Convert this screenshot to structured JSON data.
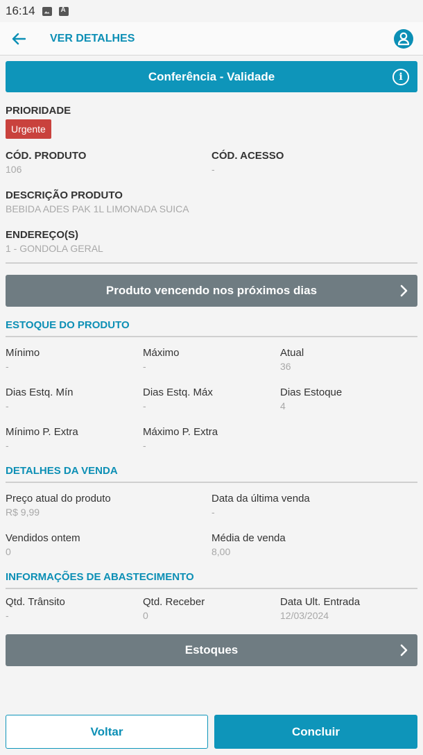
{
  "status_bar": {
    "time": "16:14"
  },
  "app_bar": {
    "title": "VER DETALHES",
    "back_icon": "arrow-left-icon",
    "user_icon": "user-icon"
  },
  "banner": {
    "title": "Conferência - Validade",
    "info_glyph": "i"
  },
  "prioridade": {
    "label": "PRIORIDADE",
    "value": "Urgente"
  },
  "produto": {
    "cod_produto_label": "CÓD. PRODUTO",
    "cod_produto_value": "106",
    "cod_acesso_label": "CÓD. ACESSO",
    "cod_acesso_value": "-",
    "descricao_label": "DESCRIÇÃO PRODUTO",
    "descricao_value": "BEBIDA ADES PAK 1L LIMONADA SUICA",
    "endereco_label": "ENDEREÇO(S)",
    "endereco_value": "1 - GONDOLA GERAL"
  },
  "vencendo_button": "Produto vencendo nos próximos dias",
  "estoque": {
    "title": "ESTOQUE DO PRODUTO",
    "minimo_label": "Mínimo",
    "minimo_value": "-",
    "maximo_label": "Máximo",
    "maximo_value": "-",
    "atual_label": "Atual",
    "atual_value": "36",
    "dias_min_label": "Dias Estq. Mín",
    "dias_min_value": "-",
    "dias_max_label": "Dias Estq. Máx",
    "dias_max_value": "-",
    "dias_estoque_label": "Dias Estoque",
    "dias_estoque_value": "4",
    "min_extra_label": "Mínimo P. Extra",
    "min_extra_value": "-",
    "max_extra_label": "Máximo P. Extra",
    "max_extra_value": "-"
  },
  "venda": {
    "title": "DETALHES DA VENDA",
    "preco_label": "Preço atual do produto",
    "preco_value": "R$ 9,99",
    "ultima_label": "Data da última venda",
    "ultima_value": "-",
    "ontem_label": "Vendidos ontem",
    "ontem_value": "0",
    "media_label": "Média de venda",
    "media_value": "8,00"
  },
  "abastecimento": {
    "title": "INFORMAÇÕES DE ABASTECIMENTO",
    "transito_label": "Qtd. Trânsito",
    "transito_value": "-",
    "receber_label": "Qtd. Receber",
    "receber_value": "0",
    "entrada_label": "Data Ult. Entrada",
    "entrada_value": "12/03/2024"
  },
  "estoques_button": "Estoques",
  "footer": {
    "voltar": "Voltar",
    "concluir": "Concluir"
  },
  "colors": {
    "accent": "#0e95ba",
    "urgent": "#c9423d",
    "gray_button": "#6f7c82"
  }
}
